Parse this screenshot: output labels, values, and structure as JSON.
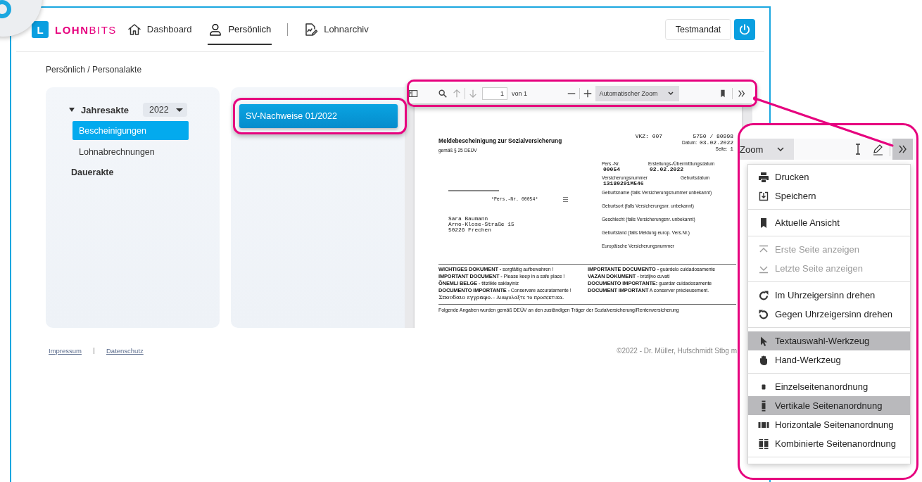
{
  "header": {
    "logo": {
      "mark": "L",
      "brand_strong": "LOHN",
      "brand_light": "BITS"
    },
    "nav": [
      {
        "label": "Dashboard",
        "selected": false
      },
      {
        "label": "Persönlich",
        "selected": true
      },
      {
        "label": "Lohnarchiv",
        "selected": false
      }
    ],
    "client_button": "Testmandat"
  },
  "breadcrumb": "Persönlich / Personalakte",
  "tree": {
    "year_folder": {
      "label": "Jahresakte",
      "expanded": true,
      "year": "2022",
      "children": [
        {
          "label": "Bescheinigungen",
          "selected": true
        },
        {
          "label": "Lohnabrechnungen",
          "selected": false
        }
      ]
    },
    "permanent_folder": {
      "label": "Dauerakte"
    }
  },
  "documents": [
    {
      "label": "SV-Nachweise 01/2022",
      "selected": true
    }
  ],
  "viewer": {
    "toolbar": {
      "page": "1",
      "page_count": "von 1",
      "zoom": "Automatischer Zoom"
    },
    "page": {
      "title": "Meldebescheinigung zur Sozialversicherung",
      "subtitle": "gemäß § 25 DEÜV",
      "vkz": "VKZ: 007",
      "reference": "5750 / 80998",
      "date_label": "Datum:",
      "date": "03.02.2022",
      "page_label": "Seite:",
      "page_no": "1",
      "pers_nr_label": "Pers.-Nr.",
      "pers_nr": "00054",
      "created_label": "Erstellungs-/Übermittlungsdatum",
      "created": "02.02.2022",
      "insurance_no_label": "Versicherungsnummer",
      "insurance_no": "13180291M546",
      "birth_date_label": "Geburtsdatum",
      "fields": [
        "Geburtsname (falls Versicherungsnummer unbekannt)",
        "Geburtsort (falls Versicherungsnr. unbekannt)",
        "Geschlecht (falls Versicherungsnr. unbekannt)",
        "Geburtsland (falls Meldung europ. Vers.Nr.)",
        "Europäische Versicherungsnummer"
      ],
      "sender_ref": "*Pers.-Nr. 00054*",
      "address": [
        "Sara Baumann",
        "Arno-Klose-Straße 15",
        "50226 Frechen"
      ],
      "notices_left": [
        {
          "kind": "bold",
          "label": "WICHTIGES DOKUMENT -",
          "note": "sorgfältig aufbewahren !"
        },
        {
          "kind": "bold",
          "label": "IMPORTANT DOCUMENT -",
          "note": "Please keep in a safe place !"
        },
        {
          "kind": "bold",
          "label": "ÖNEMLI BELGE -",
          "note": "titizlikle saklayiniz"
        },
        {
          "kind": "bold",
          "label": "DOCUMENTO IMPORTANTE -",
          "note": "Conservare accuratamente !"
        },
        {
          "kind": "serif",
          "label": "Σπουδαιο εγγραφο.–",
          "note": "Διαφυλαξτε το προσεκτικα."
        }
      ],
      "notices_right": [
        {
          "kind": "bold",
          "label": "IMPORTANTE DOCUMENTO -",
          "note": "guárdelo cuidadosamente"
        },
        {
          "kind": "bold",
          "label": "VAZAN DOKUMENT -",
          "note": "brizljivo cuvati"
        },
        {
          "kind": "bold",
          "label": "DOCUMENTO IMPORTANTE:",
          "note": "guardar cuidadosamente"
        },
        {
          "kind": "bold",
          "label": "DOCUMENT IMPORTANT",
          "note": "A conserver précieusement."
        }
      ],
      "footnote": "Folgende Angaben wurden gemäß DEÜV an den zuständigen Träger der Sozialversicherung/Rentenversicherung"
    }
  },
  "footer": {
    "links": [
      "Impressum",
      "Datenschutz"
    ],
    "copyright": "©2022 - Dr. Müller, Hufschmidt Stbg m"
  },
  "callout": {
    "zoom": "Zoom",
    "menu": [
      {
        "kind": "item",
        "label": "Drucken",
        "disabled": false,
        "selected": false
      },
      {
        "kind": "item",
        "label": "Speichern",
        "disabled": false,
        "selected": false
      },
      {
        "kind": "separator"
      },
      {
        "kind": "item",
        "label": "Aktuelle Ansicht",
        "disabled": false,
        "selected": false
      },
      {
        "kind": "separator"
      },
      {
        "kind": "item",
        "label": "Erste Seite anzeigen",
        "disabled": true,
        "selected": false
      },
      {
        "kind": "item",
        "label": "Letzte Seite anzeigen",
        "disabled": true,
        "selected": false
      },
      {
        "kind": "separator"
      },
      {
        "kind": "item",
        "label": "Im Uhrzeigersinn drehen",
        "disabled": false,
        "selected": false
      },
      {
        "kind": "item",
        "label": "Gegen Uhrzeigersinn drehen",
        "disabled": false,
        "selected": false
      },
      {
        "kind": "separator"
      },
      {
        "kind": "item",
        "label": "Textauswahl-Werkzeug",
        "disabled": false,
        "selected": true
      },
      {
        "kind": "item",
        "label": "Hand-Werkzeug",
        "disabled": false,
        "selected": false
      },
      {
        "kind": "separator"
      },
      {
        "kind": "item",
        "label": "Einzelseitenanordnung",
        "disabled": false,
        "selected": false
      },
      {
        "kind": "item",
        "label": "Vertikale Seitenanordnung",
        "disabled": false,
        "selected": true
      },
      {
        "kind": "item",
        "label": "Horizontale Seitenanordnung",
        "disabled": false,
        "selected": false
      },
      {
        "kind": "item",
        "label": "Kombinierte Seitenanordnung",
        "disabled": false,
        "selected": false
      },
      {
        "kind": "separator"
      }
    ]
  }
}
